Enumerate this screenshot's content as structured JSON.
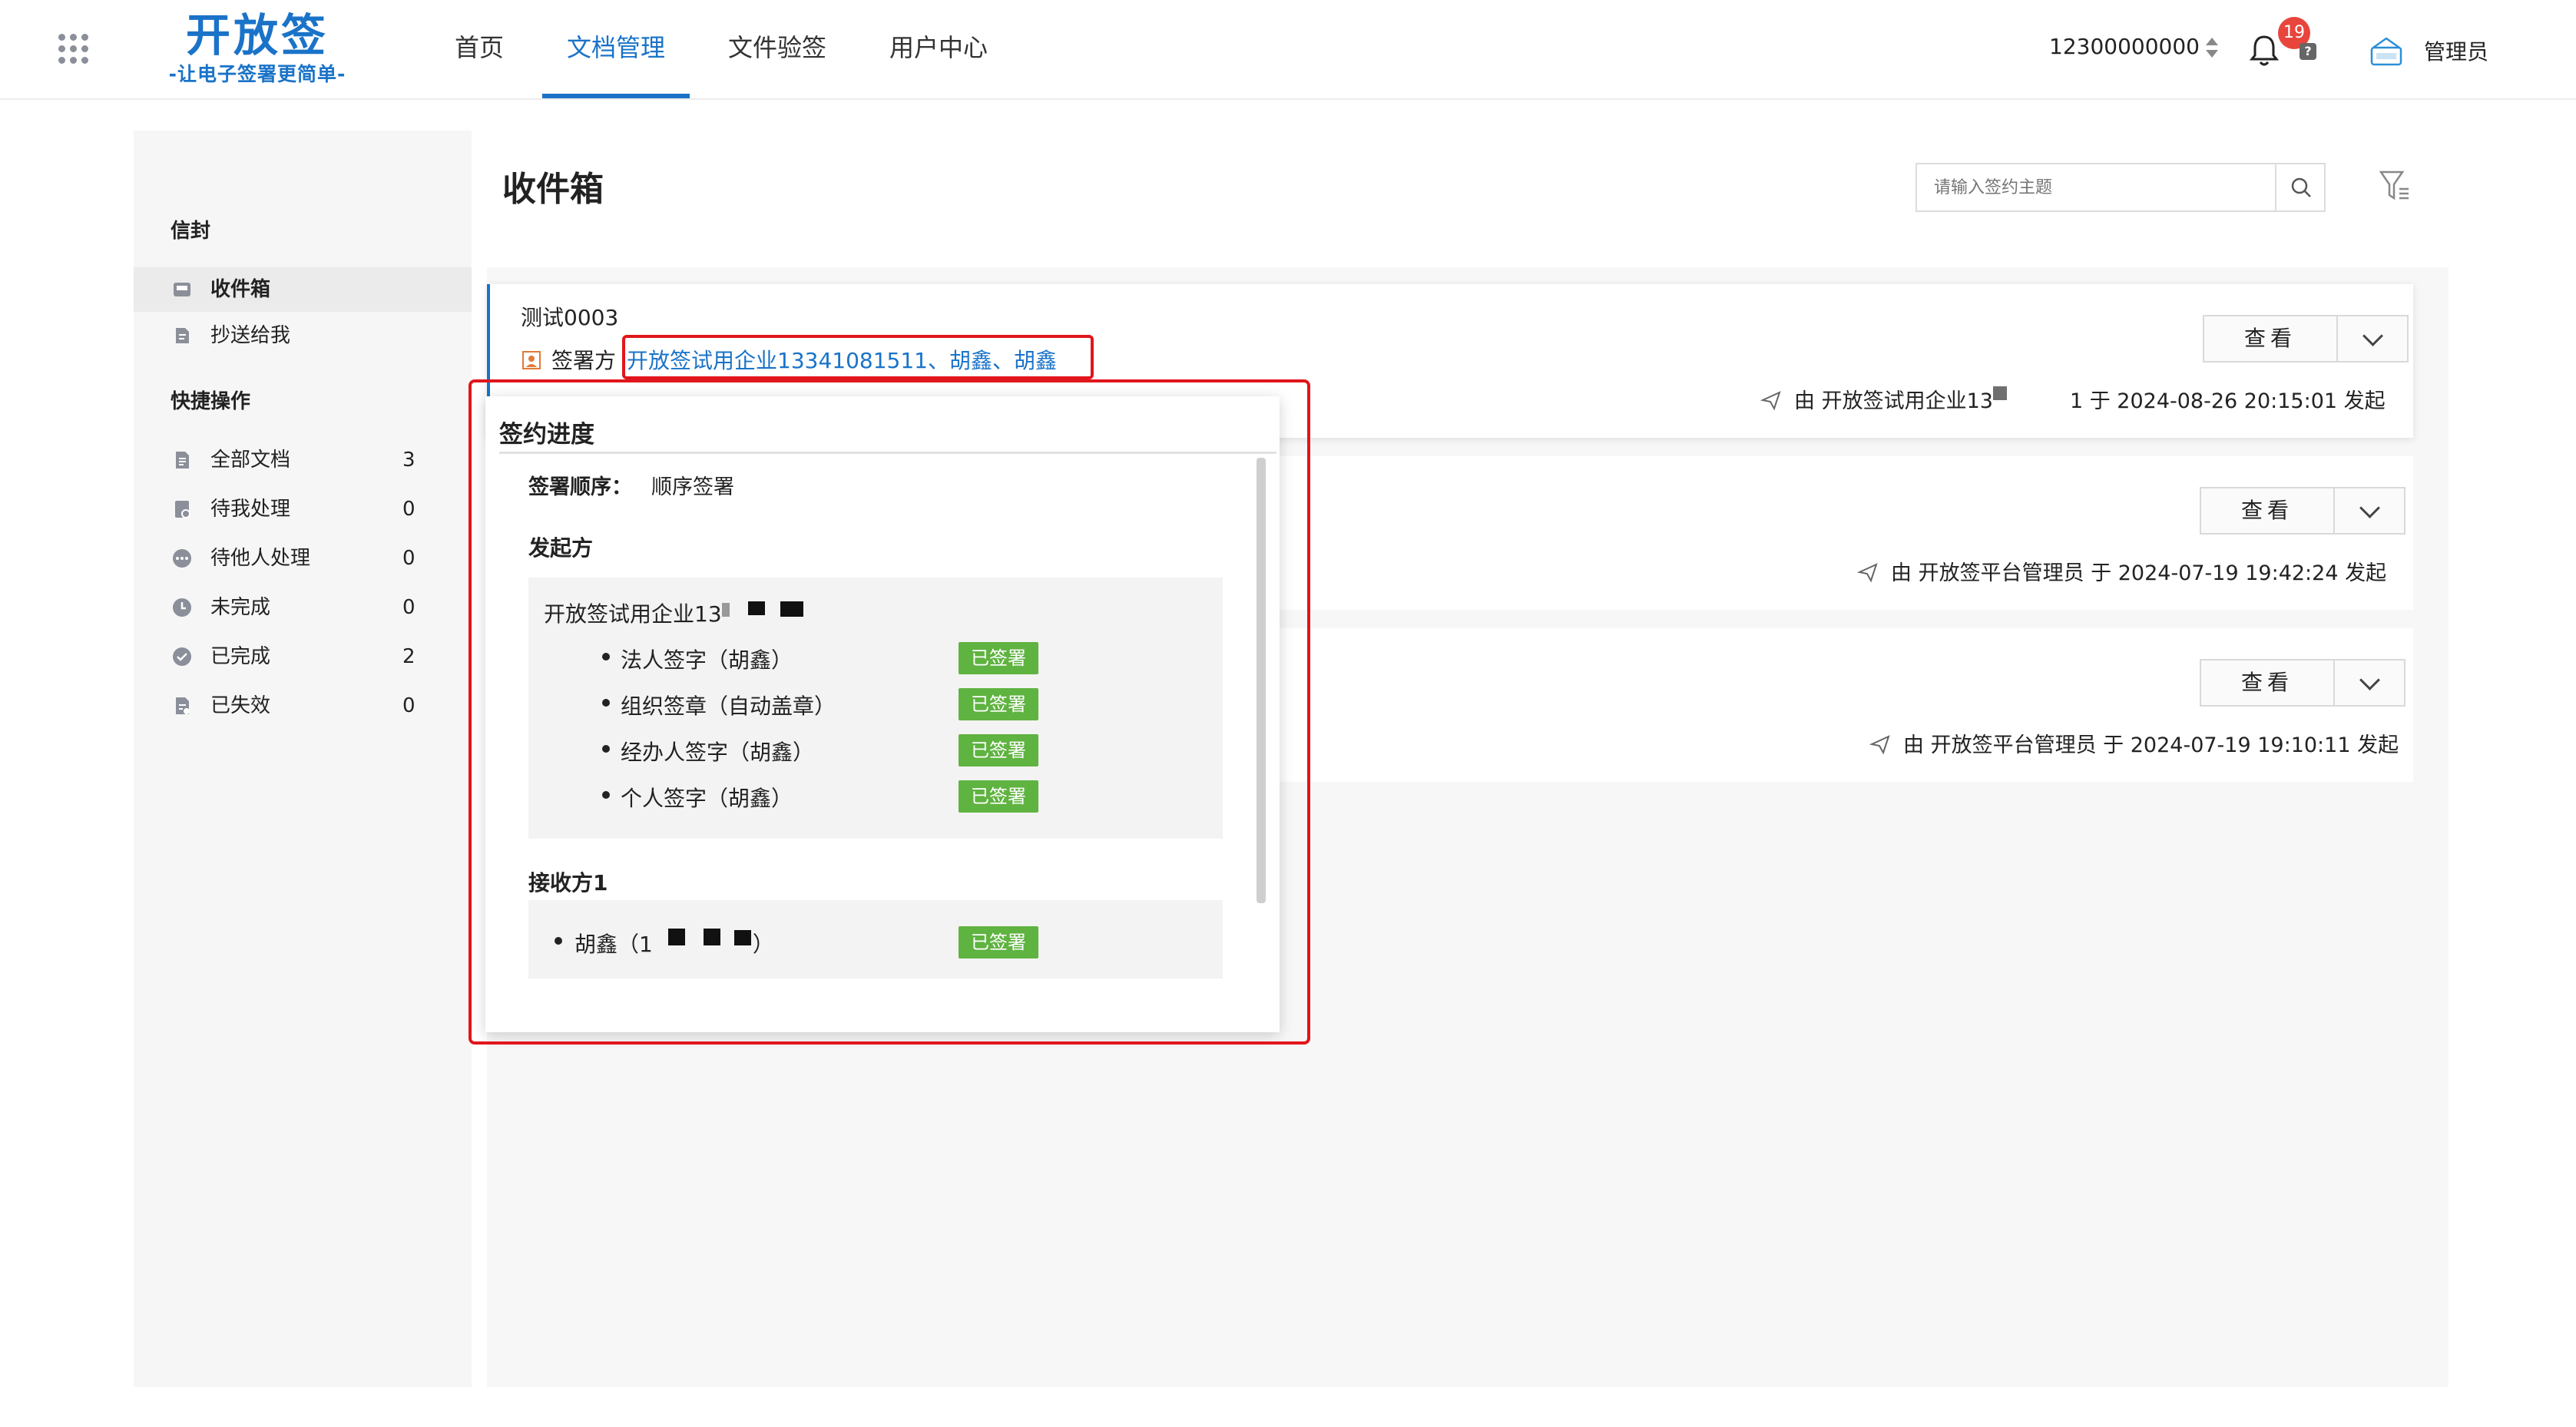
{
  "header": {
    "logo_title": "开放签",
    "logo_subtitle": "-让电子签署更简单-",
    "nav": [
      {
        "label": "首页",
        "active": false
      },
      {
        "label": "文档管理",
        "active": true
      },
      {
        "label": "文件验签",
        "active": false
      },
      {
        "label": "用户中心",
        "active": false
      }
    ],
    "phone": "12300000000",
    "notification_count": "19",
    "help_glyph": "?",
    "admin_name": "管理员"
  },
  "sidebar": {
    "envelope_heading": "信封",
    "envelope_items": [
      {
        "label": "收件箱",
        "icon": "inbox-icon",
        "active": true
      },
      {
        "label": "抄送给我",
        "icon": "cc-icon",
        "active": false
      }
    ],
    "quick_heading": "快捷操作",
    "quick_items": [
      {
        "label": "全部文档",
        "count": "3",
        "icon": "document-icon"
      },
      {
        "label": "待我处理",
        "count": "0",
        "icon": "pending-me-icon"
      },
      {
        "label": "待他人处理",
        "count": "0",
        "icon": "pending-others-icon"
      },
      {
        "label": "未完成",
        "count": "0",
        "icon": "clock-icon"
      },
      {
        "label": "已完成",
        "count": "2",
        "icon": "check-circle-icon"
      },
      {
        "label": "已失效",
        "count": "0",
        "icon": "expired-icon"
      }
    ]
  },
  "main": {
    "title": "收件箱",
    "search_placeholder": "请输入签约主题",
    "view_label": "查看",
    "cards": [
      {
        "title": "测试0003",
        "signer_label": "签署方",
        "signers": "开放签试用企业13341081511、胡鑫、胡鑫",
        "initiated_prefix": "由 开放签试用企业13",
        "initiated_suffix": "1 于 2024-08-26 20:15:01 发起"
      },
      {
        "initiated": "由 开放签平台管理员 于 2024-07-19 19:42:24 发起"
      },
      {
        "initiated": "由 开放签平台管理员 于 2024-07-19 19:10:11 发起"
      }
    ]
  },
  "popover": {
    "title": "签约进度",
    "order_label": "签署顺序：",
    "order_value": "顺序签署",
    "initiator_heading": "发起方",
    "initiator_name": "开放签试用企业13",
    "initiator_steps": [
      {
        "label": "法人签字（胡鑫）",
        "status": "已签署"
      },
      {
        "label": "组织签章（自动盖章）",
        "status": "已签署"
      },
      {
        "label": "经办人签字（胡鑫）",
        "status": "已签署"
      },
      {
        "label": "个人签字（胡鑫）",
        "status": "已签署"
      }
    ],
    "receiver_heading": "接收方1",
    "receiver": {
      "label_prefix": "胡鑫（1",
      "label_suffix": "）",
      "status": "已签署"
    }
  }
}
